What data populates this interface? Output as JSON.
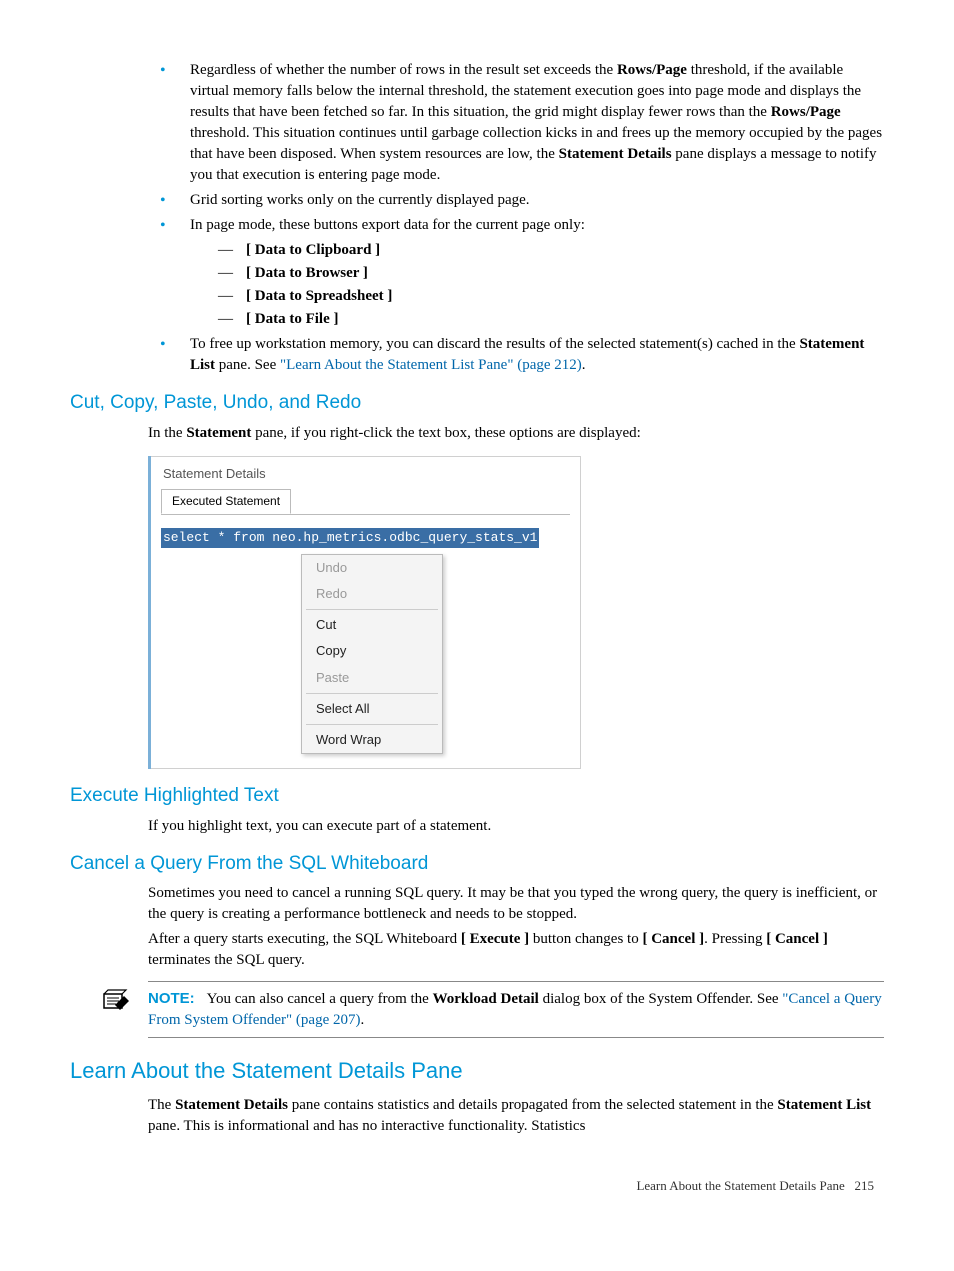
{
  "list_items": {
    "item1_part1": "Regardless of whether the number of rows in the result set exceeds the ",
    "item1_bold1": "Rows/Page",
    "item1_part2": " threshold, if the available virtual memory falls below the internal threshold, the statement execution goes into page mode and displays the results that have been fetched so far. In this situation, the grid might display fewer rows than the ",
    "item1_bold2": "Rows/Page",
    "item1_part3": " threshold. This situation continues until garbage collection kicks in and frees up the memory occupied by the pages that have been disposed. When system resources are low, the ",
    "item1_bold3": "Statement Details",
    "item1_part4": " pane displays a message to notify you that execution is entering page mode.",
    "item2": "Grid sorting works only on the currently displayed page.",
    "item3": "In page mode, these buttons export data for the current page only:",
    "sub1": "[ Data to Clipboard ]",
    "sub2": "[ Data to Browser ]",
    "sub3": "[ Data to Spreadsheet ]",
    "sub4": "[ Data to File ]",
    "item4_part1": "To free up workstation memory, you can discard the results of the selected statement(s) cached in the ",
    "item4_bold1": "Statement List",
    "item4_part2": " pane. See ",
    "item4_link": "\"Learn About the Statement List Pane\" (page 212)",
    "item4_part3": "."
  },
  "section_cut": {
    "heading": "Cut, Copy, Paste, Undo, and Redo",
    "intro_part1": "In the ",
    "intro_bold": "Statement",
    "intro_part2": " pane, if you right-click the text box, these options are displayed:"
  },
  "screenshot": {
    "panel_title": "Statement Details",
    "tab_label": "Executed Statement",
    "sql": "select * from neo.hp_metrics.odbc_query_stats_v1",
    "menu": {
      "undo": "Undo",
      "redo": "Redo",
      "cut": "Cut",
      "copy": "Copy",
      "paste": "Paste",
      "select_all": "Select All",
      "word_wrap": "Word Wrap"
    }
  },
  "section_exec": {
    "heading": "Execute Highlighted Text",
    "body": "If you highlight text, you can execute part of a statement."
  },
  "section_cancel": {
    "heading": "Cancel a Query From the SQL Whiteboard",
    "p1": "Sometimes you need to cancel a running SQL query. It may be that you typed the wrong query, the query is inefficient, or the query is creating a performance bottleneck and needs to be stopped.",
    "p2_part1": "After a query starts executing, the SQL Whiteboard ",
    "p2_bold1": "[ Execute ]",
    "p2_part2": " button changes to ",
    "p2_bold2": "[ Cancel ]",
    "p2_part3": ". Pressing ",
    "p2_bold3": "[ Cancel ]",
    "p2_part4": " terminates the SQL query."
  },
  "note": {
    "label": "NOTE:",
    "part1": "You can also cancel a query from the ",
    "bold1": "Workload Detail",
    "part2": " dialog box of the System Offender. See ",
    "link": "\"Cancel a Query From System Offender\" (page 207)",
    "part3": "."
  },
  "section_learn": {
    "heading": "Learn About the Statement Details Pane",
    "p1_part1": "The ",
    "p1_bold1": "Statement Details",
    "p1_part2": " pane contains statistics and details propagated from the selected statement in the ",
    "p1_bold2": "Statement List",
    "p1_part3": " pane. This is informational and has no interactive functionality. Statistics"
  },
  "footer": {
    "text": "Learn About the Statement Details Pane",
    "page": "215"
  }
}
